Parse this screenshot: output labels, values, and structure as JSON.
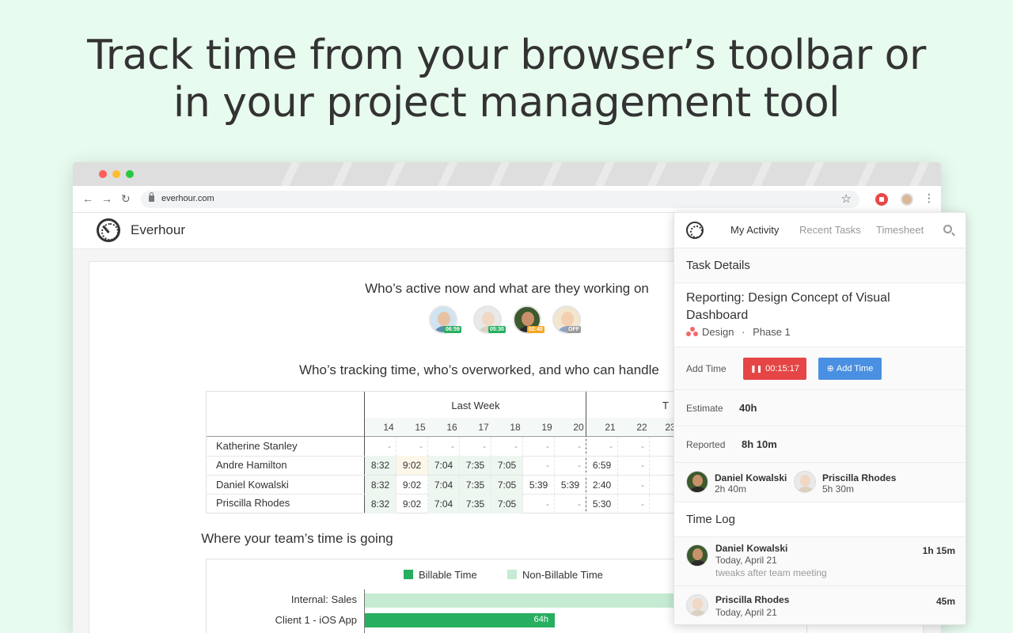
{
  "headline": {
    "line1": "Track time from your browser’s toolbar or",
    "line2": "in your project management tool"
  },
  "browser": {
    "url": "everhour.com",
    "icons": [
      "back-icon",
      "forward-icon",
      "reload-icon",
      "lock-icon",
      "star-icon",
      "record-icon",
      "kebab-icon"
    ]
  },
  "app": {
    "brand": "Everhour",
    "active_title": "Who’s active now and what are they working on",
    "active_users": [
      {
        "badge": "06:59",
        "badge_color": "#27ae60"
      },
      {
        "badge": "05:30",
        "badge_color": "#27ae60"
      },
      {
        "badge": "02:40",
        "badge_color": "#f5a623"
      },
      {
        "badge": "OFF",
        "badge_color": "#9b9b9b"
      }
    ],
    "tracking_title": "Who’s tracking time, who’s overworked, and who can handle",
    "table": {
      "week_label": "Last Week",
      "next_label": "T",
      "days": [
        "14",
        "15",
        "16",
        "17",
        "18",
        "19",
        "20",
        "21",
        "22",
        "23"
      ],
      "rows": [
        {
          "name": "Katherine Stanley",
          "cells": [
            "-",
            "-",
            "-",
            "-",
            "-",
            "-",
            "-",
            "-",
            "-"
          ]
        },
        {
          "name": "Andre Hamilton",
          "cells": [
            "8:32",
            "9:02",
            "7:04",
            "7:35",
            "7:05",
            "-",
            "-",
            "6:59",
            "-"
          ]
        },
        {
          "name": "Daniel Kowalski",
          "cells": [
            "8:32",
            "9:02",
            "7:04",
            "7:35",
            "7:05",
            "5:39",
            "5:39",
            "2:40",
            "-"
          ]
        },
        {
          "name": "Priscilla Rhodes",
          "cells": [
            "8:32",
            "9:02",
            "7:04",
            "7:35",
            "7:05",
            "-",
            "-",
            "5:30",
            "-"
          ]
        }
      ]
    },
    "chart_title": "Where your team’s time is going",
    "chart_data": {
      "type": "bar",
      "legend": [
        "Billable Time",
        "Non-Billable Time"
      ],
      "colors": {
        "billable": "#27ae60",
        "non_billable": "#c5ebd3"
      },
      "categories": [
        "Internal: Sales",
        "Client 1 - iOS App"
      ],
      "series": [
        {
          "name": "Non-Billable Time",
          "values": [
            null,
            null
          ]
        },
        {
          "name": "Billable Time",
          "values": [
            null,
            64
          ]
        }
      ],
      "data_labels": [
        "",
        "64h"
      ],
      "scale_max_hours": 107
    }
  },
  "popup": {
    "tabs": [
      "My Activity",
      "Recent Tasks",
      "Timesheet"
    ],
    "task_details_label": "Task Details",
    "task_title": "Reporting: Design Concept of Visual Dashboard",
    "project": "Design",
    "separator": "·",
    "phase": "Phase 1",
    "add_time_label": "Add Time",
    "timer_value": "00:15:17",
    "add_time_button": "Add Time",
    "estimate_label": "Estimate",
    "estimate_value": "40h",
    "reported_label": "Reported",
    "reported_value": "8h 10m",
    "contributors": [
      {
        "name": "Daniel Kowalski",
        "time": "2h 40m"
      },
      {
        "name": "Priscilla Rhodes",
        "time": "5h 30m"
      }
    ],
    "time_log_label": "Time Log",
    "log": [
      {
        "name": "Daniel Kowalski",
        "date": "Today, April 21",
        "note": "tweaks after team meeting",
        "duration": "1h 15m"
      },
      {
        "name": "Priscilla Rhodes",
        "date": "Today, April 21",
        "note": "",
        "duration": "45m"
      }
    ]
  },
  "colors": {
    "accent_green": "#27ae60",
    "timer_red": "#e64545",
    "button_blue": "#4a90e2",
    "page_bg": "#e8fbef"
  }
}
